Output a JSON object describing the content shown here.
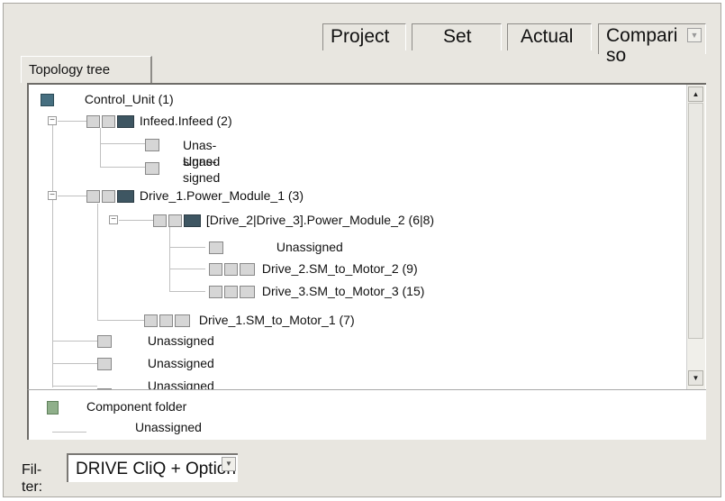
{
  "toolbar": {
    "project": "Project",
    "set": "Set",
    "actual": "Actual",
    "compare": "Compari so"
  },
  "topology_tab": "Topology tree",
  "tree": {
    "control_unit": "Control_Unit (1)",
    "infeed": "Infeed.Infeed (2)",
    "infeed_child_1": "Unas- signed",
    "infeed_child_2": "Unas- signed",
    "drive1_power_module": "Drive_1.Power_Module_1 (3)",
    "power_module_2": "[Drive_2|Drive_3].Power_Module_2 (6|8)",
    "pm2_unassigned": "Unassigned",
    "sm_motor_2": "Drive_2.SM_to_Motor_2 (9)",
    "sm_motor_3": "Drive_3.SM_to_Motor_3 (15)",
    "sm_motor_1": "Drive_1.SM_to_Motor_1 (7)",
    "unassigned_a": "Unassigned",
    "unassigned_b": "Unassigned",
    "unassigned_c": "Unassigned"
  },
  "component_folder": {
    "label": "Component folder",
    "child": "Unassigned"
  },
  "filter": {
    "label": "Fil- ter:",
    "value": "DRIVE CliQ + Option"
  },
  "icons": {
    "control_unit": "control-unit-icon",
    "module": "module-icon",
    "folder": "folder-icon",
    "scroll_up": "arrow-up-icon",
    "scroll_down": "arrow-down-icon",
    "dropdown": "chevron-down-icon"
  }
}
